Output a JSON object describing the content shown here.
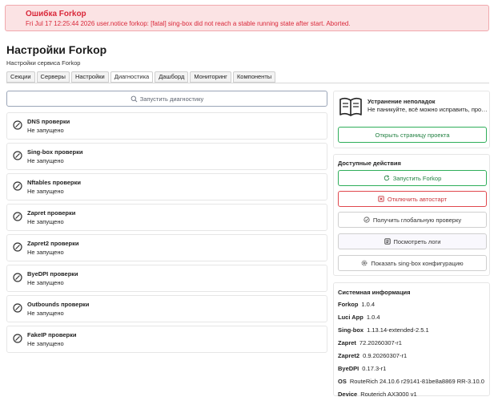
{
  "alert": {
    "title": "Ошибка Forkop",
    "message": "Fri Jul 17 12:25:44 2026 user.notice forkop: [fatal] sing-box did not reach a stable running state after start. Aborted.",
    "color": "#d9283a"
  },
  "header": {
    "title": "Настройки Forkop",
    "subtitle": "Настройки сервиса Forkop"
  },
  "tabs": [
    {
      "label": "Секции"
    },
    {
      "label": "Серверы"
    },
    {
      "label": "Настройки"
    },
    {
      "label": "Диагностика",
      "active": true
    },
    {
      "label": "Дашборд"
    },
    {
      "label": "Мониторинг"
    },
    {
      "label": "Компоненты"
    }
  ],
  "diagnostics": {
    "run_label": "Запустить диагностику",
    "run_icon": "search-icon",
    "checks": [
      {
        "name": "DNS проверки",
        "status": "Не запущено"
      },
      {
        "name": "Sing-box проверки",
        "status": "Не запущено"
      },
      {
        "name": "Nftables проверки",
        "status": "Не запущено"
      },
      {
        "name": "Zapret проверки",
        "status": "Не запущено"
      },
      {
        "name": "Zapret2 проверки",
        "status": "Не запущено"
      },
      {
        "name": "ByeDPI проверки",
        "status": "Не запущено"
      },
      {
        "name": "Outbounds проверки",
        "status": "Не запущено"
      },
      {
        "name": "FakeIP проверки",
        "status": "Не запущено"
      }
    ]
  },
  "troubleshooting": {
    "title": "Устранение неполадок",
    "description": "Не паникуйте, всё можно исправить, просто...",
    "button": "Открыть страницу проекта",
    "icon": "book-icon"
  },
  "actions": {
    "title": "Доступные действия",
    "start": "Запустить Forkop",
    "disable_autostart": "Отключить автостарт",
    "global_check": "Получить глобальную проверку",
    "view_logs": "Посмотреть логи",
    "show_config": "Показать sing-box конфигурацию",
    "green": "#2fae5a",
    "red": "#e0484e"
  },
  "sysinfo": {
    "title": "Системная информация",
    "rows": [
      {
        "key": "Forkop",
        "value": "1.0.4"
      },
      {
        "key": "Luci App",
        "value": "1.0.4"
      },
      {
        "key": "Sing-box",
        "value": "1.13.14-extended-2.5.1"
      },
      {
        "key": "Zapret",
        "value": "72.20260307-r1"
      },
      {
        "key": "Zapret2",
        "value": "0.9.20260307-r1"
      },
      {
        "key": "ByeDPI",
        "value": "0.17.3-r1"
      },
      {
        "key": "OS",
        "value": "RouteRich 24.10.6 r29141-81be8a8869 RR-3.10.0"
      },
      {
        "key": "Device",
        "value": "Routerich AX3000 v1"
      }
    ]
  }
}
